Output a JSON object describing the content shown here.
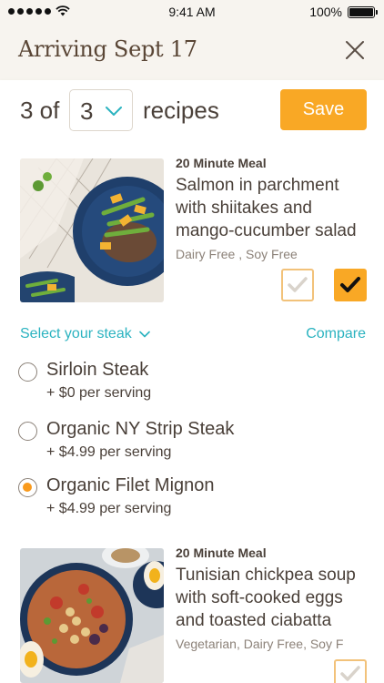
{
  "status_bar": {
    "time": "9:41 AM",
    "battery": "100%"
  },
  "header": {
    "title": "Arriving Sept 17"
  },
  "recipe_selector": {
    "count_prefix": "3 of",
    "selected": "3",
    "suffix": "recipes",
    "save_label": "Save"
  },
  "recipes": [
    {
      "tag": "20 Minute Meal",
      "title_lines": [
        "Salmon in parchment",
        "with shiitakes and",
        "mango-cucumber salad"
      ],
      "diet": "Dairy Free ,  Soy Free"
    },
    {
      "tag": "20 Minute Meal",
      "title_lines": [
        "Tunisian chickpea soup",
        "with soft-cooked eggs",
        "and toasted ciabatta"
      ],
      "diet": "Vegetarian,  Dairy Free,  Soy F"
    }
  ],
  "steak": {
    "select_label": "Select your steak",
    "compare_label": "Compare",
    "options": [
      {
        "name": "Sirloin Steak",
        "price": "+ $0 per serving"
      },
      {
        "name": "Organic NY Strip Steak",
        "price": "+ $4.99 per serving"
      },
      {
        "name": "Organic Filet Mignon",
        "price": "+ $4.99 per serving"
      }
    ],
    "selected_index": 2
  },
  "colors": {
    "accent": "#f9a825",
    "link": "#2bb3c0",
    "header_bg": "#f7f4ef",
    "text": "#4a4039"
  },
  "icons": [
    "wifi-icon",
    "battery-icon",
    "close-icon",
    "chevron-down-icon",
    "check-icon"
  ]
}
